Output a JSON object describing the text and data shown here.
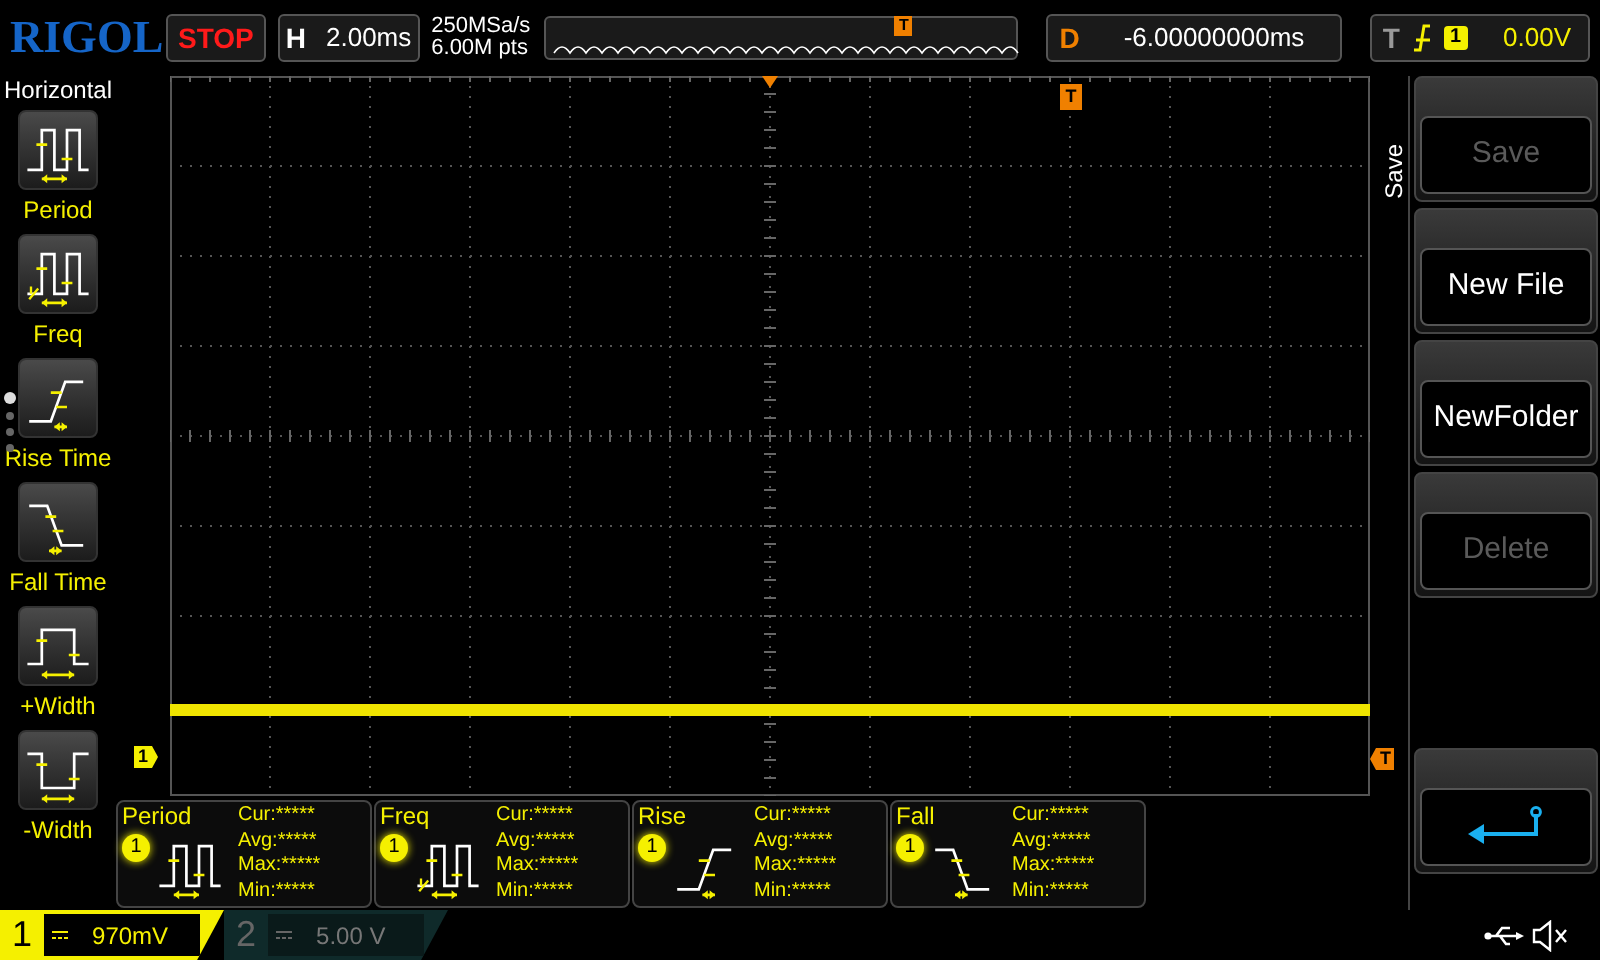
{
  "brand": "RIGOL",
  "run_state": "STOP",
  "horizontal": {
    "label": "H",
    "timebase": "2.00ms",
    "sample_rate": "250MSa/s",
    "memory_depth": "6.00M pts"
  },
  "delay": {
    "label": "D",
    "value": "-6.00000000ms"
  },
  "trigger": {
    "label": "T",
    "source": "1",
    "level": "0.00V"
  },
  "left_menu": {
    "title": "Horizontal",
    "items": [
      {
        "label": "Period",
        "kind": "period"
      },
      {
        "label": "Freq",
        "kind": "freq"
      },
      {
        "label": "Rise Time",
        "kind": "rise"
      },
      {
        "label": "Fall Time",
        "kind": "fall"
      },
      {
        "label": "+Width",
        "kind": "pwidth"
      },
      {
        "label": "-Width",
        "kind": "nwidth"
      }
    ],
    "pages": [
      {
        "selected": true
      },
      {
        "selected": false
      },
      {
        "selected": false
      },
      {
        "selected": false
      }
    ]
  },
  "overview": {
    "trigger_marker": "T"
  },
  "grid": {
    "channel_marker": "1",
    "trigger_position_marker": "T",
    "trigger_level_marker": "T"
  },
  "measurements": [
    {
      "name": "Period",
      "channel": "1",
      "kind": "period",
      "lines": [
        "Cur:*****",
        "Avg:*****",
        "Max:*****",
        "Min:*****"
      ]
    },
    {
      "name": "Freq",
      "channel": "1",
      "kind": "freq",
      "lines": [
        "Cur:*****",
        "Avg:*****",
        "Max:*****",
        "Min:*****"
      ]
    },
    {
      "name": "Rise",
      "channel": "1",
      "kind": "rise",
      "lines": [
        "Cur:*****",
        "Avg:*****",
        "Max:*****",
        "Min:*****"
      ]
    },
    {
      "name": "Fall",
      "channel": "1",
      "kind": "fall",
      "lines": [
        "Cur:*****",
        "Avg:*****",
        "Max:*****",
        "Min:*****"
      ]
    }
  ],
  "right_menu": {
    "title": "Save",
    "buttons": [
      {
        "kind": "text",
        "label": "Save",
        "disabled": true
      },
      {
        "kind": "text",
        "label": "New File",
        "disabled": false
      },
      {
        "kind": "text",
        "label": "NewFolder",
        "disabled": false
      },
      {
        "kind": "text",
        "label": "Delete",
        "disabled": true
      },
      {
        "kind": "spacer"
      },
      {
        "kind": "back"
      }
    ]
  },
  "channels": [
    {
      "number": "1",
      "scale": "970mV",
      "on": true
    },
    {
      "number": "2",
      "scale": "5.00 V",
      "on": false
    }
  ]
}
